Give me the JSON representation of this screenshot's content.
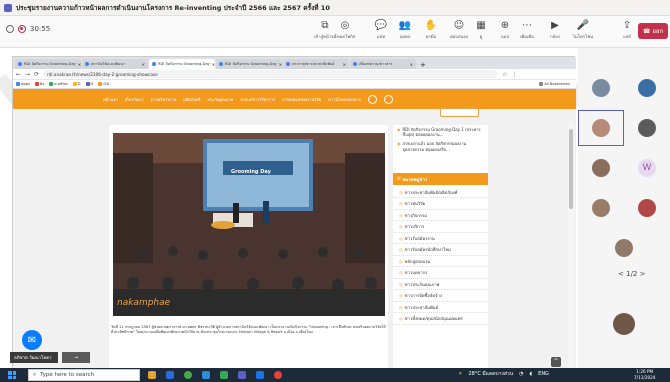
{
  "meeting": {
    "title": "ประชุมรายงานความก้าวหน้าผลการดำเนินงานโครงการ Re-inventing ประจำปี 2566 และ 2567 ครั้งที่ 10",
    "timer": "30:55",
    "toolbar": [
      {
        "icon": "screen-icon",
        "label": "เข้าสู่หน้าจอ"
      },
      {
        "icon": "focus-icon",
        "label": "โหมดโฟกัส"
      },
      {
        "icon": "chat-icon",
        "label": "แชท"
      },
      {
        "icon": "people-icon",
        "label": "บุคคล"
      },
      {
        "icon": "raise-hand-icon",
        "label": "ยกมือ"
      },
      {
        "icon": "react-icon",
        "label": "ตอบสนอง"
      },
      {
        "icon": "view-icon",
        "label": "ดู"
      },
      {
        "icon": "apps-icon",
        "label": "แอป"
      },
      {
        "icon": "more-icon",
        "label": "เพิ่มเติม"
      },
      {
        "icon": "camera-icon",
        "label": "กล้อง"
      },
      {
        "icon": "mic-icon",
        "label": "ไมโครโฟน"
      },
      {
        "icon": "share-icon",
        "label": "แชร์"
      }
    ],
    "leave_label": "ออก"
  },
  "browser": {
    "tabs": [
      "RDI จัดกิจกรรม Grooming-Day",
      "สถาบันวิจัยและพัฒนา",
      "RDI จัดกิจกรรม Grooming-Day",
      "RDI จัดกิจกรรม Grooming-Day",
      "ประกาศ/ข่าวประชาสัมพันธ์",
      "เพิ่มบทความ/ข่าวสาร"
    ],
    "url": "rdi.anakrae.th/news/2306-day-2-grooming-showcase",
    "bookmarks": [
      "Apps",
      "8x",
      "e-office",
      "D",
      "D",
      "ISA",
      "All Bookmarks"
    ]
  },
  "site": {
    "nav": [
      "หน้าแรก",
      "เกี่ยวกับเรา",
      "การบริหารงาน",
      "ผลิตภัณฑ์",
      "ประกันคุณภาพ",
      "ระบบบริการวิชาการ",
      "การเผยแพร่ผลงานวิจัย",
      "ดาวน์โหลดเอกสาร"
    ],
    "photo_banner": "Grooming Day",
    "watermark": "nakamphae",
    "caption": "วันที่ 11 กรกฎาคม 2567 ผู้ช่วยศาสตราจารย์ ดร.ยศพร พัชรประกิติ ผู้อำนวยการสถาบันวิจัยและพัฒนา เป็นประธานเปิดกิจกรรม \"Grooming : เจาะลึกทักษะ ส่งเสริมผลงานวิจัยให้มีประสิทธิภาพ\" โดยประกอบเพื่อพัฒนาศักยภาพนักวิจัย ณ ห้องประชุมโรงแรมเมกะ Horizon Village & Resort อ.เมือง จ.เชียงใหม่",
    "related": [
      "RDI จัดกิจกรรม Grooming-Day 1 (ประหารสิ้นสุด) ต่อยอดผลงาน...",
      "สวพ.ผกาแล้ว มอบ จัดกิจกรรมผลงานอุตสาหกรรม ต่อยอดเสร็จ..."
    ],
    "category_title": "หมวดหมู่ข่าว",
    "categories": [
      "ข่าวประชาสัมพันธ์/ผลิตภัณฑ์",
      "ข่าวทุนวิจัย",
      "ข่าวกิจกรรม",
      "ข่าวบริการ",
      "ข่าวรับสมัครงาน",
      "ข่าวรับสมัครนักศึกษาใหม่",
      "หลักสูตรอบรม",
      "ข่าวบุคลากร",
      "ข่าวประกันคุณภาพ",
      "ข่าวการจัดซื้อจัดจ้าง",
      "ข่าวประชาสัมพันธ์",
      "ข่าวทั้งหมด/ทุนสนับสนุนเผยแพร่"
    ]
  },
  "participants": {
    "pager": "1/2",
    "initial": "W"
  },
  "overlay": {
    "speaker": "อภิชาต วัฒนาโคตร"
  },
  "taskbar": {
    "search_placeholder": "Type here to search",
    "weather": "28°C มีแดดบางส่วน",
    "lang": "ENG",
    "time": "1:26 PM",
    "date": "7/11/2024"
  }
}
